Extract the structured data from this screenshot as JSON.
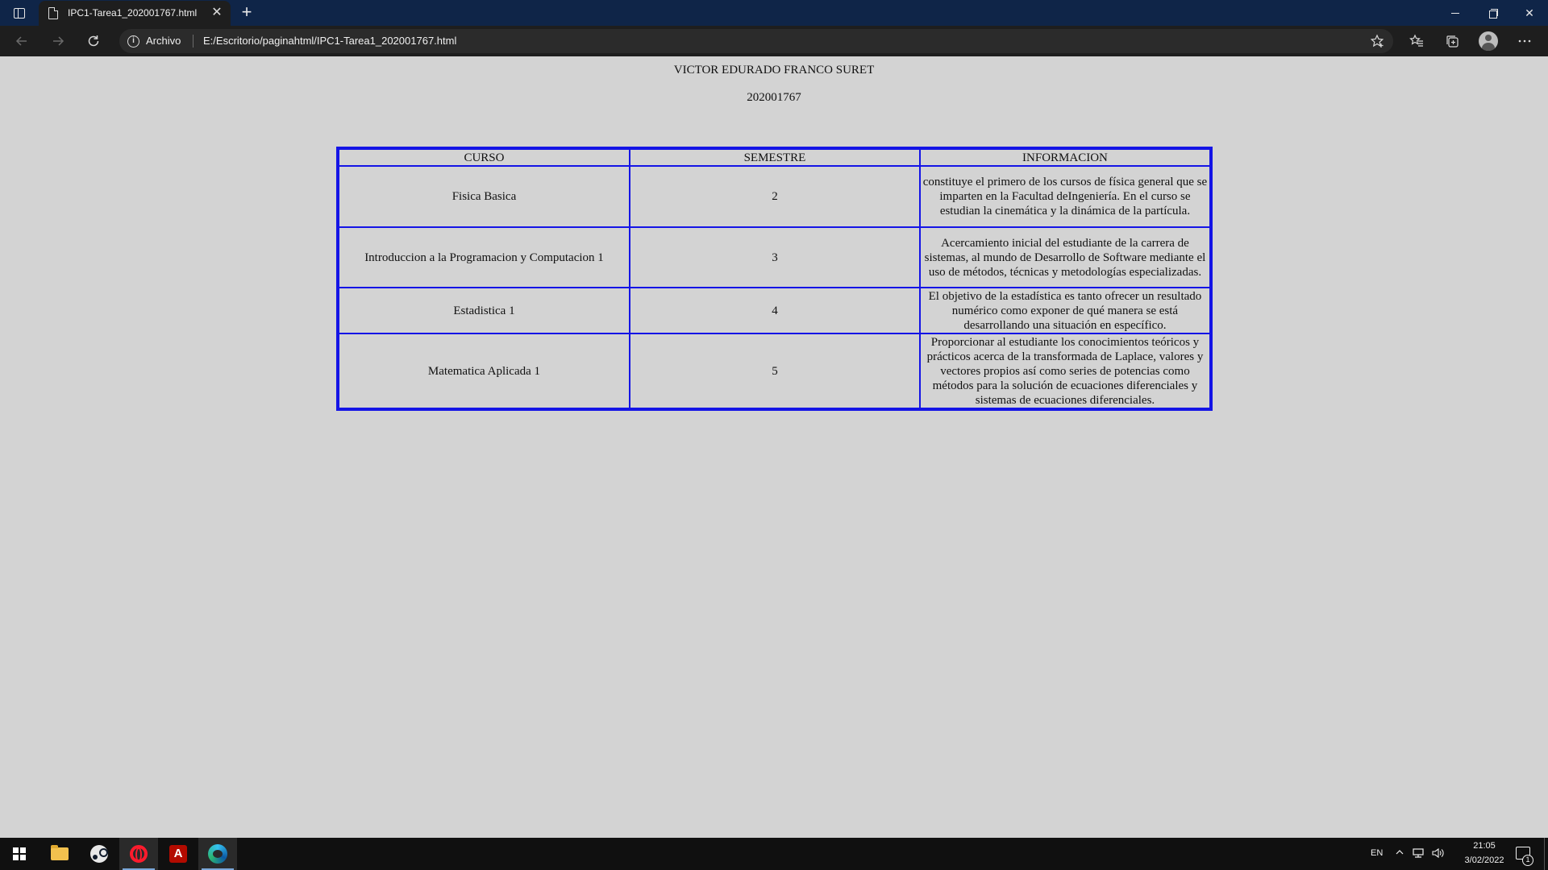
{
  "browser": {
    "tab_title": "IPC1-Tarea1_202001767.html",
    "close_symbol": "✕",
    "new_tab_symbol": "+",
    "info_symbol": "i",
    "site_label": "Archivo",
    "url": "E:/Escritorio/paginahtml/IPC1-Tarea1_202001767.html",
    "icons": [
      "tab-actions-icon",
      "document-icon",
      "back-arrow-icon",
      "forward-arrow-icon",
      "refresh-icon",
      "info-icon",
      "add-favorite-icon",
      "favorites-icon",
      "collections-icon",
      "profile-icon",
      "more-icon",
      "minimize-icon",
      "restore-icon",
      "close-icon"
    ]
  },
  "page": {
    "name": "VICTOR EDURADO FRANCO SURET",
    "carnet": "202001767",
    "table": {
      "headers": [
        "CURSO",
        "SEMESTRE",
        "INFORMACION"
      ],
      "rows": [
        {
          "curso": "Fisica Basica",
          "semestre": "2",
          "informacion": "constituye el primero de los cursos de física general que se imparten en la Facultad deIngeniería. En el curso se estudian la cinemática y la dinámica de la partícula."
        },
        {
          "curso": "Introduccion a la Programacion y Computacion 1",
          "semestre": "3",
          "informacion": "Acercamiento inicial del estudiante de la carrera de sistemas, al mundo de Desarrollo de Software mediante el uso de métodos, técnicas y metodologías especializadas."
        },
        {
          "curso": "Estadistica 1",
          "semestre": "4",
          "informacion": "El objetivo de la estadística es tanto ofrecer un resultado numérico como exponer de qué manera se está desarrollando una situación en específico."
        },
        {
          "curso": "Matematica Aplicada 1",
          "semestre": "5",
          "informacion": "Proporcionar al estudiante los conocimientos teóricos y prácticos acerca de la transformada de Laplace, valores y vectores propios así como series de potencias como métodos para la solución de ecuaciones diferenciales y sistemas de ecuaciones diferenciales."
        }
      ]
    }
  },
  "taskbar": {
    "apps": [
      "start-icon",
      "file-explorer-icon",
      "steam-icon",
      "opera-icon",
      "acrobat-icon",
      "edge-icon"
    ],
    "acrobat_glyph": "A",
    "language": "EN",
    "time": "21:05",
    "date": "3/02/2022",
    "notification_count": "1"
  },
  "colors": {
    "page_background": "#d3d3d3",
    "table_border": "#1414e6",
    "titlebar": "#0f2548",
    "toolbar": "#1e1e1e",
    "taskbar": "#101010"
  }
}
